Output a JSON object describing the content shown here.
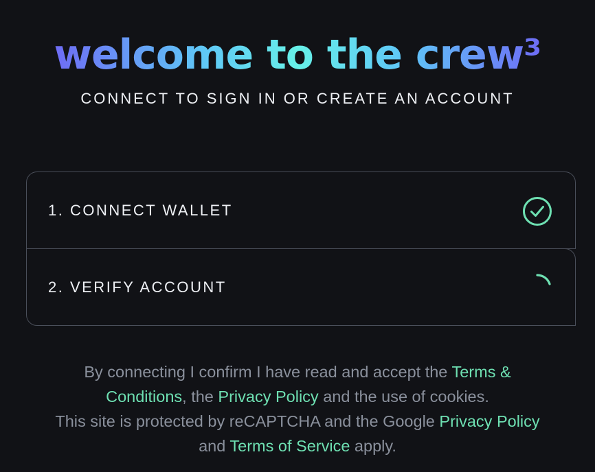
{
  "header": {
    "title": "welcome to the crew",
    "title_suffix": "³",
    "subtitle": "CONNECT TO SIGN IN OR CREATE AN ACCOUNT"
  },
  "steps": [
    {
      "label": "1. CONNECT WALLET",
      "status_icon": "check-circle-icon",
      "status": "complete"
    },
    {
      "label": "2. VERIFY ACCOUNT",
      "status_icon": "spinner-icon",
      "status": "loading"
    }
  ],
  "legal": {
    "line1_prefix": "By connecting I confirm I have read and accept the ",
    "terms_conditions": "Terms & Conditions",
    "comma_the": ", the ",
    "privacy_policy": "Privacy Policy",
    "cookies_suffix": " and the use of cookies.",
    "line2_prefix": "This site is protected by reCAPTCHA and the Google ",
    "google_privacy_policy": "Privacy Policy",
    "and": "and ",
    "terms_of_service": "Terms of Service",
    "apply": " apply."
  },
  "colors": {
    "background": "#111216",
    "accent_green": "#6ee0b2",
    "gradient_blue": "#6e6cf5",
    "gradient_cyan": "#67f0e8",
    "border": "#4a4f5a",
    "muted_text": "#8a909c"
  }
}
